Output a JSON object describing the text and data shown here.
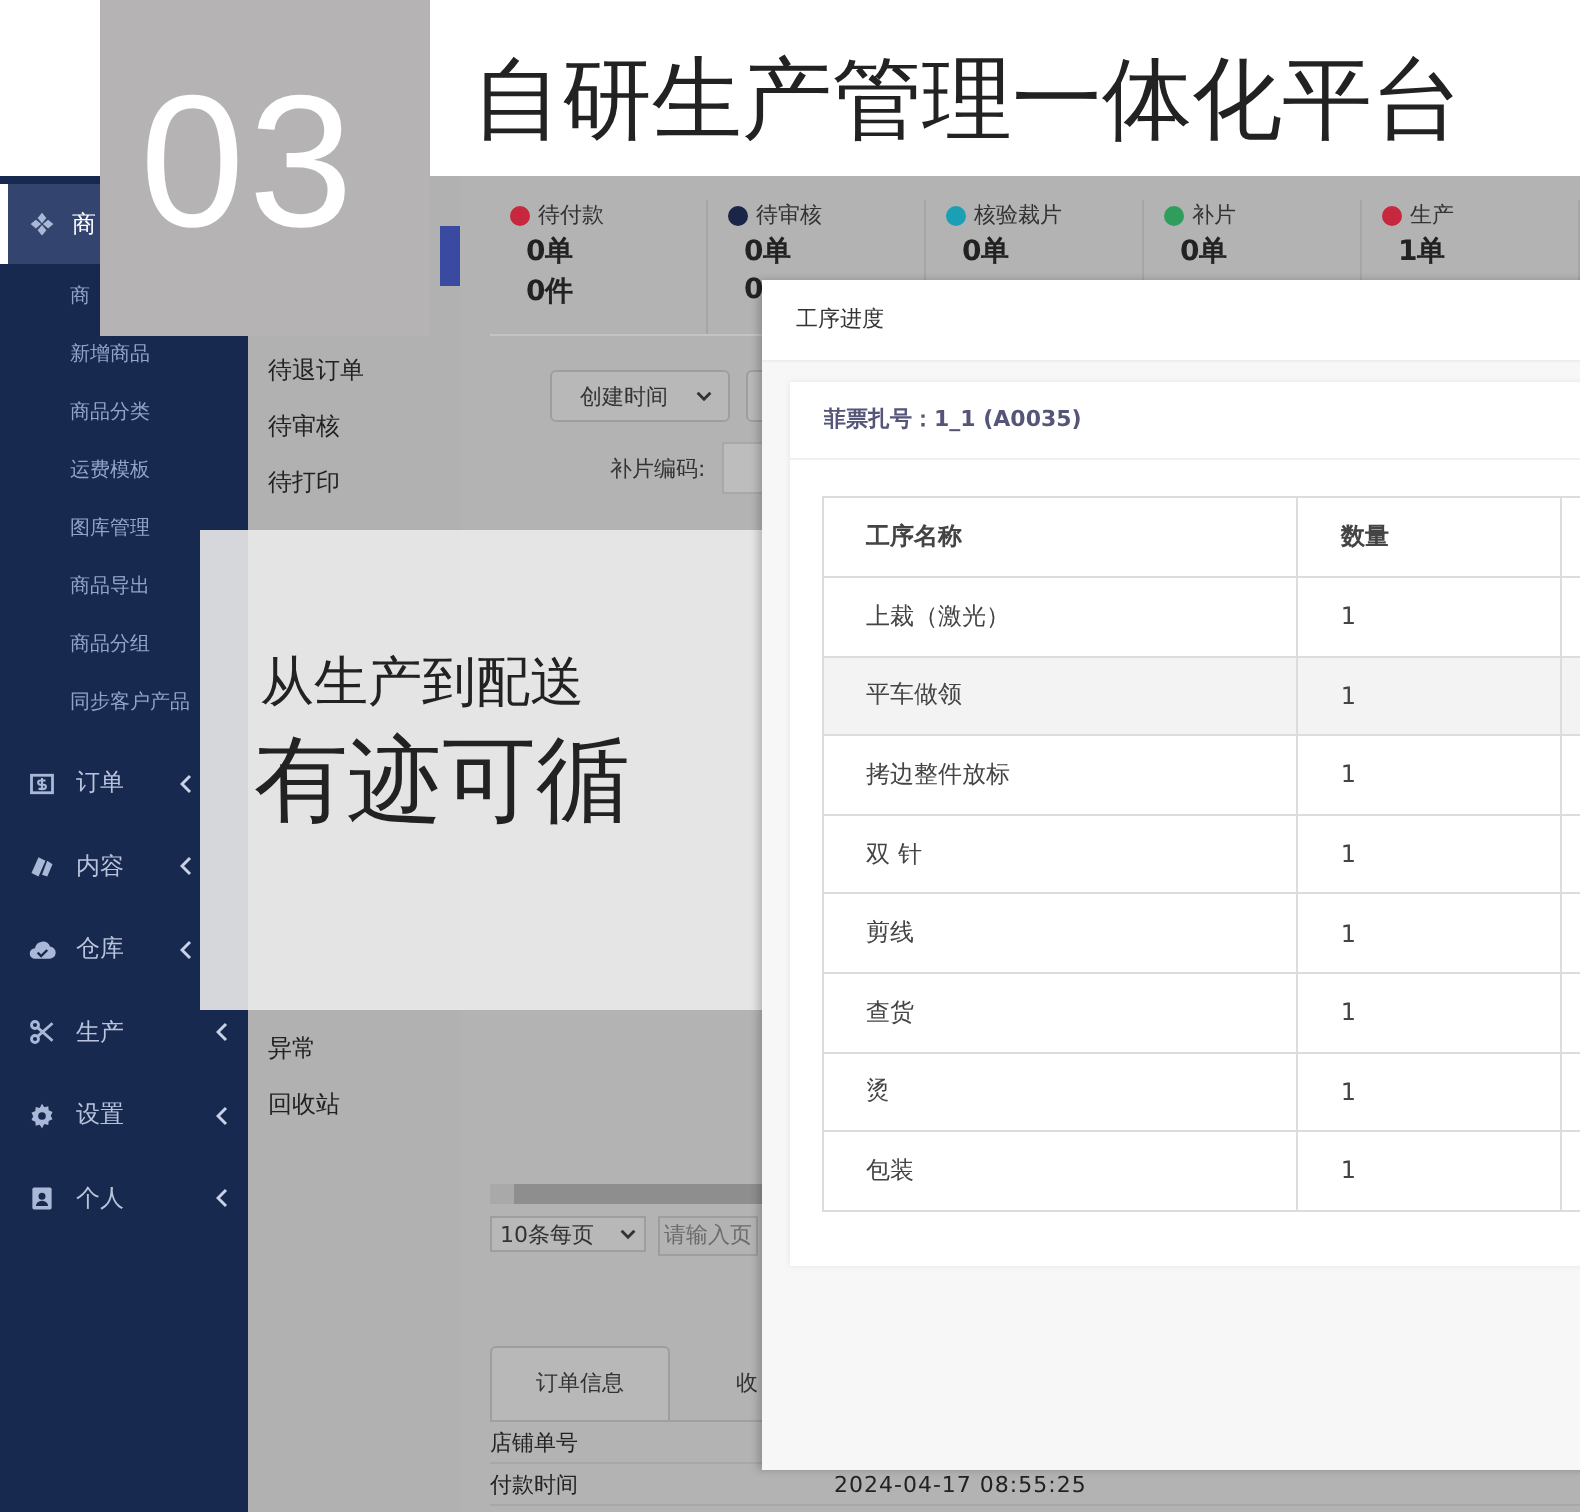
{
  "banner": {
    "number": "03",
    "title": "自研生产管理一体化平台"
  },
  "slogan": {
    "line_1": "从生产到配送",
    "line_2": "有迹可循"
  },
  "sidebar": {
    "items": [
      {
        "label": "商",
        "selected": true,
        "expanded": true,
        "children": [
          {
            "label": "商"
          },
          {
            "label": "新增商品"
          },
          {
            "label": "商品分类"
          },
          {
            "label": "运费模板"
          },
          {
            "label": "图库管理"
          },
          {
            "label": "商品导出"
          },
          {
            "label": "商品分组"
          },
          {
            "label": "同步客户产品"
          }
        ]
      },
      {
        "label": "订单",
        "selected": false,
        "expanded": false
      },
      {
        "label": "内容",
        "selected": false,
        "expanded": false
      },
      {
        "label": "仓库",
        "selected": false,
        "expanded": false
      },
      {
        "label": "生产",
        "selected": false,
        "expanded": false
      },
      {
        "label": "设置",
        "selected": false,
        "expanded": false
      },
      {
        "label": "个人",
        "selected": false,
        "expanded": false
      }
    ]
  },
  "submenu": {
    "groups": [
      [
        {
          "label": "待退订单"
        },
        {
          "label": "待审核"
        },
        {
          "label": "待打印"
        }
      ],
      [
        {
          "label": "异常"
        },
        {
          "label": "回收站"
        }
      ]
    ]
  },
  "stats": [
    {
      "label": "待付款",
      "color": "#c8283f",
      "orders": "0单",
      "pieces": "0件"
    },
    {
      "label": "待审核",
      "color": "#1b2548",
      "orders": "0单",
      "pieces": "0"
    },
    {
      "label": "核验裁片",
      "color": "#1a9fb5",
      "orders": "0单"
    },
    {
      "label": "补片",
      "color": "#2f9e5d",
      "orders": "0单"
    },
    {
      "label": "生产",
      "color": "#c8283f",
      "orders": "1单"
    }
  ],
  "filters": {
    "sort_select": "创建时间",
    "patch_code_label": "补片编码:"
  },
  "pagination": {
    "page_size": "10条每页",
    "page_placeholder": "请输入页"
  },
  "detail_tabs": [
    {
      "label": "订单信息",
      "selected": true
    },
    {
      "label": "收",
      "selected": false
    }
  ],
  "detail_rows": [
    {
      "label": "店铺单号"
    },
    {
      "label": "付款时间",
      "value": "2024-04-17 08:55:25"
    }
  ],
  "dialog": {
    "title": "工序进度",
    "ticket": "菲票扎号：1_1 (A0035)",
    "table": {
      "columns": [
        "工序名称",
        "数量"
      ],
      "rows": [
        {
          "cells": [
            "上裁（激光）",
            "1"
          ],
          "highlighted": false
        },
        {
          "cells": [
            "平车做领",
            "1"
          ],
          "highlighted": true
        },
        {
          "cells": [
            "拷边整件放标",
            "1"
          ],
          "highlighted": false
        },
        {
          "cells": [
            "双 针",
            "1"
          ],
          "highlighted": false
        },
        {
          "cells": [
            "剪线",
            "1"
          ],
          "highlighted": false
        },
        {
          "cells": [
            "查货",
            "1"
          ],
          "highlighted": false
        },
        {
          "cells": [
            "烫",
            "1"
          ],
          "highlighted": false
        },
        {
          "cells": [
            "包装",
            "1"
          ],
          "highlighted": false
        }
      ]
    }
  }
}
